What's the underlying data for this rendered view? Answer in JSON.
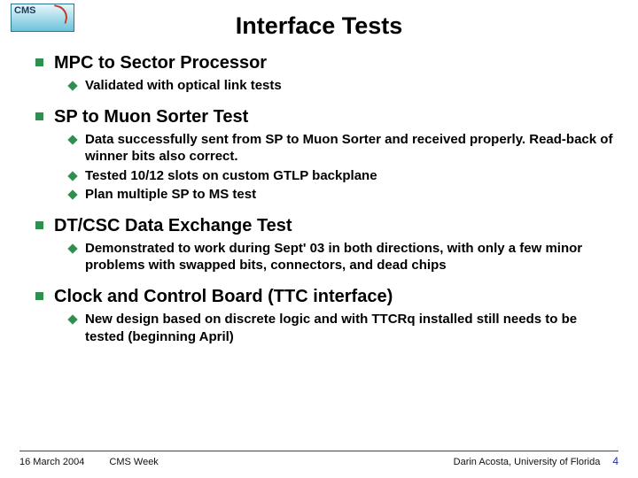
{
  "logo_text": "CMS",
  "title": "Interface Tests",
  "sections": [
    {
      "heading": "MPC to Sector Processor",
      "bullets": [
        "Validated with optical link tests"
      ]
    },
    {
      "heading": "SP to Muon Sorter Test",
      "bullets": [
        "Data successfully sent from SP to Muon Sorter and received properly. Read-back of winner bits also correct.",
        "Tested 10/12 slots on custom GTLP backplane",
        "Plan multiple SP to MS test"
      ]
    },
    {
      "heading": "DT/CSC Data Exchange Test",
      "bullets": [
        "Demonstrated to work during Sept' 03 in both directions, with only a few minor problems with swapped bits, connectors, and dead chips"
      ]
    },
    {
      "heading": "Clock and Control Board (TTC interface)",
      "bullets": [
        "New design based on discrete logic and with TTCRq installed still needs to be tested (beginning April)"
      ]
    }
  ],
  "footer": {
    "date": "16 March 2004",
    "event": "CMS Week",
    "affiliation": "Darin Acosta, University of Florida",
    "page": "4"
  }
}
